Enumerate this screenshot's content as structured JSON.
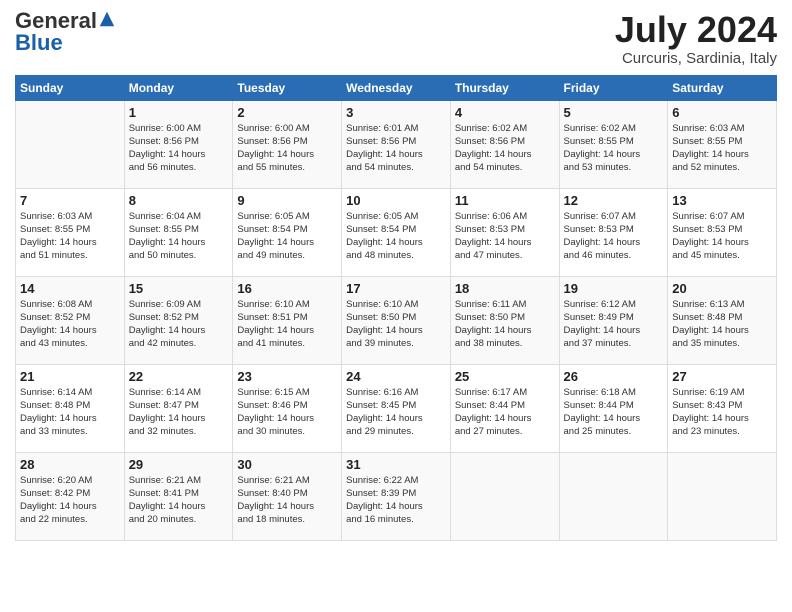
{
  "header": {
    "logo_general": "General",
    "logo_blue": "Blue",
    "month_title": "July 2024",
    "subtitle": "Curcuris, Sardinia, Italy"
  },
  "weekdays": [
    "Sunday",
    "Monday",
    "Tuesday",
    "Wednesday",
    "Thursday",
    "Friday",
    "Saturday"
  ],
  "weeks": [
    [
      {
        "day": "",
        "info": ""
      },
      {
        "day": "1",
        "info": "Sunrise: 6:00 AM\nSunset: 8:56 PM\nDaylight: 14 hours\nand 56 minutes."
      },
      {
        "day": "2",
        "info": "Sunrise: 6:00 AM\nSunset: 8:56 PM\nDaylight: 14 hours\nand 55 minutes."
      },
      {
        "day": "3",
        "info": "Sunrise: 6:01 AM\nSunset: 8:56 PM\nDaylight: 14 hours\nand 54 minutes."
      },
      {
        "day": "4",
        "info": "Sunrise: 6:02 AM\nSunset: 8:56 PM\nDaylight: 14 hours\nand 54 minutes."
      },
      {
        "day": "5",
        "info": "Sunrise: 6:02 AM\nSunset: 8:55 PM\nDaylight: 14 hours\nand 53 minutes."
      },
      {
        "day": "6",
        "info": "Sunrise: 6:03 AM\nSunset: 8:55 PM\nDaylight: 14 hours\nand 52 minutes."
      }
    ],
    [
      {
        "day": "7",
        "info": "Sunrise: 6:03 AM\nSunset: 8:55 PM\nDaylight: 14 hours\nand 51 minutes."
      },
      {
        "day": "8",
        "info": "Sunrise: 6:04 AM\nSunset: 8:55 PM\nDaylight: 14 hours\nand 50 minutes."
      },
      {
        "day": "9",
        "info": "Sunrise: 6:05 AM\nSunset: 8:54 PM\nDaylight: 14 hours\nand 49 minutes."
      },
      {
        "day": "10",
        "info": "Sunrise: 6:05 AM\nSunset: 8:54 PM\nDaylight: 14 hours\nand 48 minutes."
      },
      {
        "day": "11",
        "info": "Sunrise: 6:06 AM\nSunset: 8:53 PM\nDaylight: 14 hours\nand 47 minutes."
      },
      {
        "day": "12",
        "info": "Sunrise: 6:07 AM\nSunset: 8:53 PM\nDaylight: 14 hours\nand 46 minutes."
      },
      {
        "day": "13",
        "info": "Sunrise: 6:07 AM\nSunset: 8:53 PM\nDaylight: 14 hours\nand 45 minutes."
      }
    ],
    [
      {
        "day": "14",
        "info": "Sunrise: 6:08 AM\nSunset: 8:52 PM\nDaylight: 14 hours\nand 43 minutes."
      },
      {
        "day": "15",
        "info": "Sunrise: 6:09 AM\nSunset: 8:52 PM\nDaylight: 14 hours\nand 42 minutes."
      },
      {
        "day": "16",
        "info": "Sunrise: 6:10 AM\nSunset: 8:51 PM\nDaylight: 14 hours\nand 41 minutes."
      },
      {
        "day": "17",
        "info": "Sunrise: 6:10 AM\nSunset: 8:50 PM\nDaylight: 14 hours\nand 39 minutes."
      },
      {
        "day": "18",
        "info": "Sunrise: 6:11 AM\nSunset: 8:50 PM\nDaylight: 14 hours\nand 38 minutes."
      },
      {
        "day": "19",
        "info": "Sunrise: 6:12 AM\nSunset: 8:49 PM\nDaylight: 14 hours\nand 37 minutes."
      },
      {
        "day": "20",
        "info": "Sunrise: 6:13 AM\nSunset: 8:48 PM\nDaylight: 14 hours\nand 35 minutes."
      }
    ],
    [
      {
        "day": "21",
        "info": "Sunrise: 6:14 AM\nSunset: 8:48 PM\nDaylight: 14 hours\nand 33 minutes."
      },
      {
        "day": "22",
        "info": "Sunrise: 6:14 AM\nSunset: 8:47 PM\nDaylight: 14 hours\nand 32 minutes."
      },
      {
        "day": "23",
        "info": "Sunrise: 6:15 AM\nSunset: 8:46 PM\nDaylight: 14 hours\nand 30 minutes."
      },
      {
        "day": "24",
        "info": "Sunrise: 6:16 AM\nSunset: 8:45 PM\nDaylight: 14 hours\nand 29 minutes."
      },
      {
        "day": "25",
        "info": "Sunrise: 6:17 AM\nSunset: 8:44 PM\nDaylight: 14 hours\nand 27 minutes."
      },
      {
        "day": "26",
        "info": "Sunrise: 6:18 AM\nSunset: 8:44 PM\nDaylight: 14 hours\nand 25 minutes."
      },
      {
        "day": "27",
        "info": "Sunrise: 6:19 AM\nSunset: 8:43 PM\nDaylight: 14 hours\nand 23 minutes."
      }
    ],
    [
      {
        "day": "28",
        "info": "Sunrise: 6:20 AM\nSunset: 8:42 PM\nDaylight: 14 hours\nand 22 minutes."
      },
      {
        "day": "29",
        "info": "Sunrise: 6:21 AM\nSunset: 8:41 PM\nDaylight: 14 hours\nand 20 minutes."
      },
      {
        "day": "30",
        "info": "Sunrise: 6:21 AM\nSunset: 8:40 PM\nDaylight: 14 hours\nand 18 minutes."
      },
      {
        "day": "31",
        "info": "Sunrise: 6:22 AM\nSunset: 8:39 PM\nDaylight: 14 hours\nand 16 minutes."
      },
      {
        "day": "",
        "info": ""
      },
      {
        "day": "",
        "info": ""
      },
      {
        "day": "",
        "info": ""
      }
    ]
  ]
}
